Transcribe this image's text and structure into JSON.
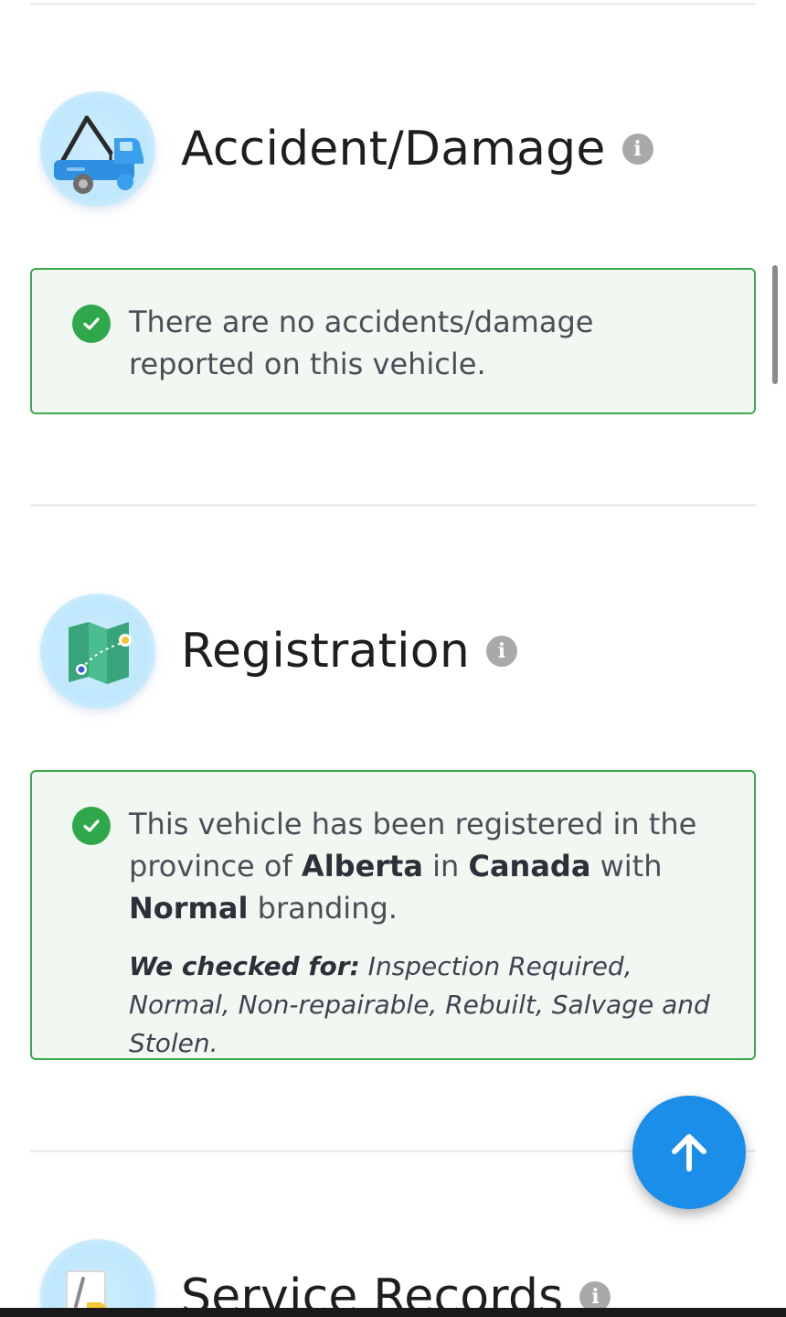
{
  "accident": {
    "title": "Accident/Damage",
    "info_icon": "i",
    "status": "There are no accidents/damage reported on this vehicle."
  },
  "registration": {
    "title": "Registration",
    "info_icon": "i",
    "status_parts": {
      "p1": "This vehicle has been registered in the province of ",
      "province": "Alberta",
      "p2": " in ",
      "country": "Canada",
      "p3": " with ",
      "branding": "Normal",
      "p4": " branding."
    },
    "checked_label": "We checked for:",
    "checked_items": " Inspection Required, Normal, Non-repairable, Rebuilt, Salvage and Stolen."
  },
  "service": {
    "title": "Service Records",
    "info_icon": "i"
  },
  "colors": {
    "success_green": "#2ea84a",
    "box_border": "#3da84f",
    "box_bg": "#f1f8f2",
    "fab_blue": "#1a8ee8"
  },
  "icons": {
    "accident": "tow-truck-icon",
    "registration": "map-icon",
    "service": "service-folder-icon",
    "check": "check-circle-icon",
    "info": "info-icon",
    "fab": "arrow-up-icon"
  }
}
